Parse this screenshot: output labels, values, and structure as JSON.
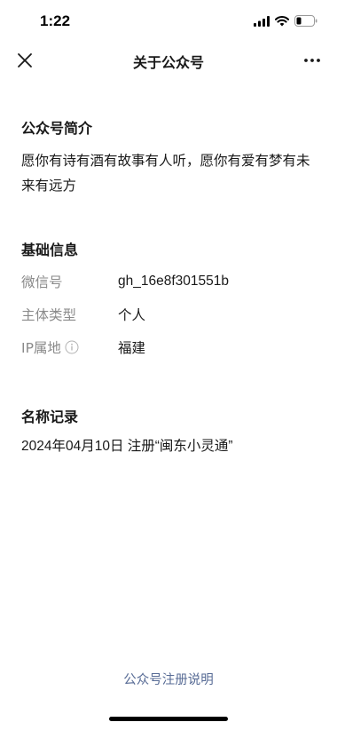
{
  "status_bar": {
    "time": "1:22"
  },
  "nav": {
    "title": "关于公众号",
    "close_icon": "close-icon",
    "more_icon": "more-icon"
  },
  "intro": {
    "heading": "公众号简介",
    "text": "愿你有诗有酒有故事有人听，愿你有爱有梦有未来有远方"
  },
  "basic_info": {
    "heading": "基础信息",
    "rows": [
      {
        "label": "微信号",
        "value": "gh_16e8f301551b"
      },
      {
        "label": "主体类型",
        "value": "个人"
      },
      {
        "label": "IP属地",
        "value": "福建"
      }
    ]
  },
  "name_record": {
    "heading": "名称记录",
    "entry": "2024年04月10日 注册“闽东小灵通”"
  },
  "footer": {
    "link": "公众号注册说明"
  },
  "colors": {
    "link": "#576b95",
    "label_gray": "#8a8a8a",
    "text": "#191919"
  }
}
